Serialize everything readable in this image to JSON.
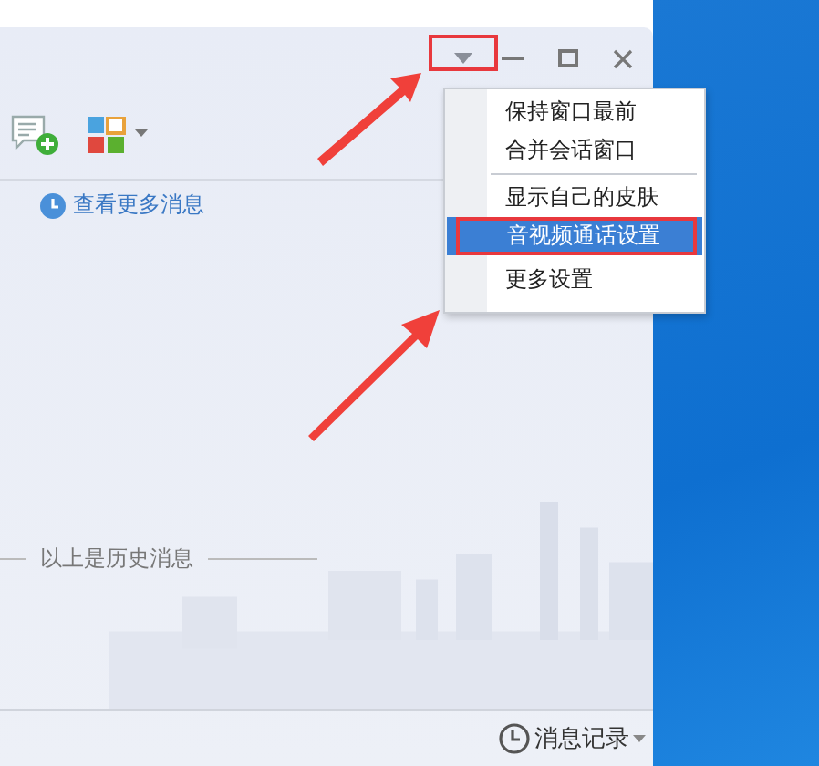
{
  "more_messages_link": "查看更多消息",
  "history_divider": "以上是历史消息",
  "message_record_button": "消息记录",
  "menu": {
    "items": [
      {
        "kind": "item",
        "label": "保持窗口最前",
        "selected": false
      },
      {
        "kind": "item",
        "label": "合并会话窗口",
        "selected": false
      },
      {
        "kind": "separator"
      },
      {
        "kind": "item",
        "label": "显示自己的皮肤",
        "selected": false
      },
      {
        "kind": "item",
        "label": "音视频通话设置",
        "selected": true
      },
      {
        "kind": "item",
        "label": "更多设置",
        "selected": false
      }
    ]
  }
}
